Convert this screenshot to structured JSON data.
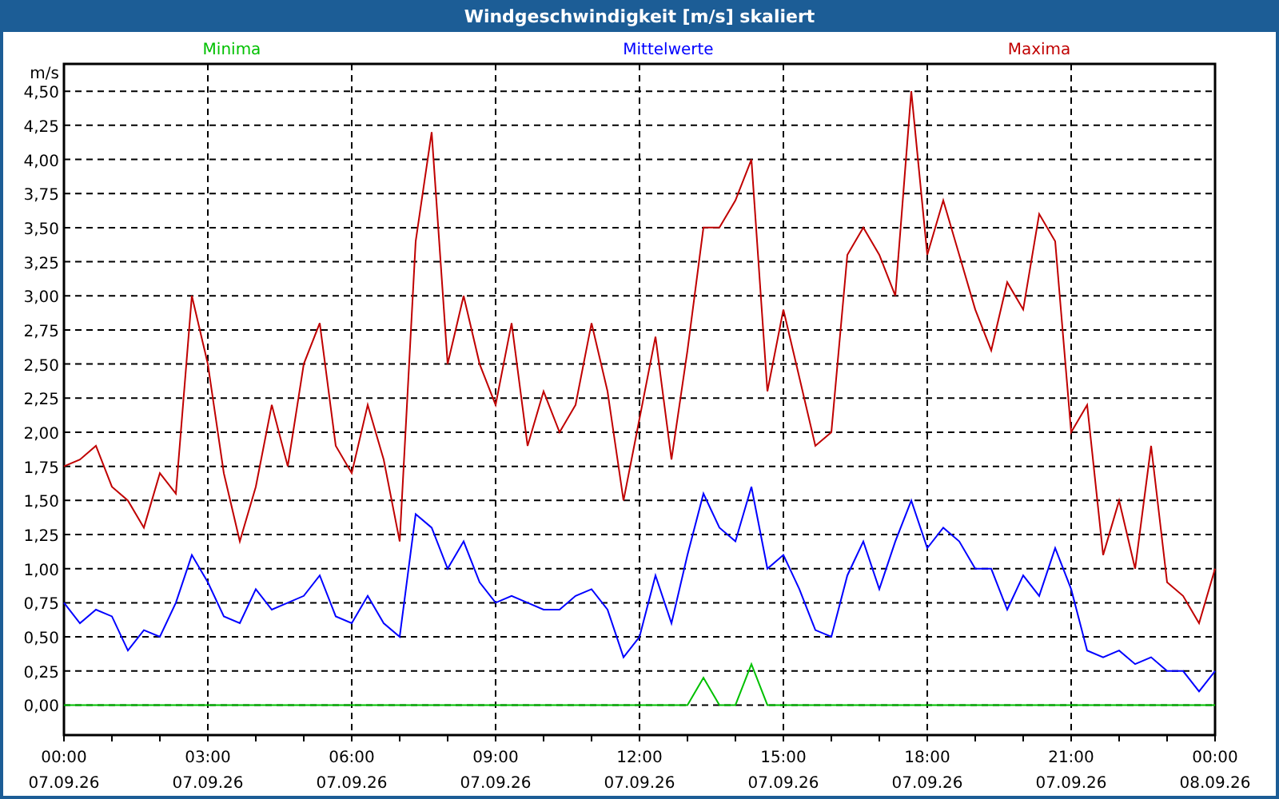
{
  "window": {
    "title": "Windgeschwindigkeit [m/s] skaliert"
  },
  "chart": {
    "chart_data": {
      "type": "line",
      "ylabel": "m/s",
      "categories": [
        "00:00 07.09.26",
        null,
        null,
        null,
        null,
        null,
        null,
        null,
        null,
        "03:00 07.09.26",
        null,
        null,
        null,
        null,
        null,
        null,
        null,
        null,
        "06:00 07.09.26",
        null,
        null,
        null,
        null,
        null,
        null,
        null,
        null,
        "09:00 07.09.26",
        null,
        null,
        null,
        null,
        null,
        null,
        null,
        null,
        "12:00 07.09.26",
        null,
        null,
        null,
        null,
        null,
        null,
        null,
        null,
        "15:00 07.09.26",
        null,
        null,
        null,
        null,
        null,
        null,
        null,
        null,
        "18:00 07.09.26",
        null,
        null,
        null,
        null,
        null,
        null,
        null,
        null,
        "21:00 07.09.26",
        null,
        null,
        null,
        null,
        null,
        null,
        null,
        null,
        "00:00 08.09.26"
      ],
      "series": [
        {
          "name": "Minima",
          "color": "#00c000",
          "values": [
            0,
            0,
            0,
            0,
            0,
            0,
            0,
            0,
            0,
            0,
            0,
            0,
            0,
            0,
            0,
            0,
            0,
            0,
            0,
            0,
            0,
            0,
            0,
            0,
            0,
            0,
            0,
            0,
            0,
            0,
            0,
            0,
            0,
            0,
            0,
            0,
            0,
            0,
            0,
            0,
            0.2,
            0,
            0,
            0.3,
            0,
            0,
            0,
            0,
            0,
            0,
            0,
            0,
            0,
            0,
            0,
            0,
            0,
            0,
            0,
            0,
            0,
            0,
            0,
            0,
            0,
            0,
            0,
            0,
            0,
            0,
            0,
            0,
            0
          ]
        },
        {
          "name": "Mittelwerte",
          "color": "#0000ff",
          "values": [
            0.75,
            0.6,
            0.7,
            0.65,
            0.4,
            0.55,
            0.5,
            0.75,
            1.1,
            0.9,
            0.65,
            0.6,
            0.85,
            0.7,
            0.75,
            0.8,
            0.95,
            0.65,
            0.6,
            0.8,
            0.6,
            0.5,
            1.4,
            1.3,
            1.0,
            1.2,
            0.9,
            0.75,
            0.8,
            0.75,
            0.7,
            0.7,
            0.8,
            0.85,
            0.7,
            0.35,
            0.5,
            0.95,
            0.6,
            1.1,
            1.55,
            1.3,
            1.2,
            1.6,
            1.0,
            1.1,
            0.85,
            0.55,
            0.5,
            0.95,
            1.2,
            0.85,
            1.2,
            1.5,
            1.15,
            1.3,
            1.2,
            1.0,
            1.0,
            0.7,
            0.95,
            0.8,
            1.15,
            0.85,
            0.4,
            0.35,
            0.4,
            0.3,
            0.35,
            0.25,
            0.25,
            0.1,
            0.25
          ]
        },
        {
          "name": "Maxima",
          "color": "#c00000",
          "values": [
            1.75,
            1.8,
            1.9,
            1.6,
            1.5,
            1.3,
            1.7,
            1.55,
            3.0,
            2.5,
            1.7,
            1.2,
            1.6,
            2.2,
            1.75,
            2.5,
            2.8,
            1.9,
            1.7,
            2.2,
            1.8,
            1.2,
            3.4,
            4.2,
            2.5,
            3.0,
            2.5,
            2.2,
            2.8,
            1.9,
            2.3,
            2.0,
            2.2,
            2.8,
            2.3,
            1.5,
            2.1,
            2.7,
            1.8,
            2.6,
            3.5,
            3.5,
            3.7,
            4.0,
            2.3,
            2.9,
            2.4,
            1.9,
            2.0,
            3.3,
            3.5,
            3.3,
            3.0,
            4.5,
            3.3,
            3.7,
            3.3,
            2.9,
            2.6,
            3.1,
            2.9,
            3.6,
            3.4,
            2.0,
            2.2,
            1.1,
            1.5,
            1.0,
            1.9,
            0.9,
            0.8,
            0.6,
            1.0
          ]
        }
      ],
      "grid": true,
      "ylim": [
        -0.22,
        4.7
      ],
      "yticks": [
        {
          "value": 0,
          "label": "0,00"
        },
        {
          "value": 0.25,
          "label": "0,25"
        },
        {
          "value": 0.5,
          "label": "0,50"
        },
        {
          "value": 0.75,
          "label": "0,75"
        },
        {
          "value": 1,
          "label": "1,00"
        },
        {
          "value": 1.25,
          "label": "1,25"
        },
        {
          "value": 1.5,
          "label": "1,50"
        },
        {
          "value": 1.75,
          "label": "1,75"
        },
        {
          "value": 2,
          "label": "2,00"
        },
        {
          "value": 2.25,
          "label": "2,25"
        },
        {
          "value": 2.5,
          "label": "2,50"
        },
        {
          "value": 2.75,
          "label": "2,75"
        },
        {
          "value": 3,
          "label": "3,00"
        },
        {
          "value": 3.25,
          "label": "3,25"
        },
        {
          "value": 3.5,
          "label": "3,50"
        },
        {
          "value": 3.75,
          "label": "3,75"
        },
        {
          "value": 4,
          "label": "4,00"
        },
        {
          "value": 4.25,
          "label": "4,25"
        },
        {
          "value": 4.5,
          "label": "4,50"
        }
      ]
    }
  }
}
